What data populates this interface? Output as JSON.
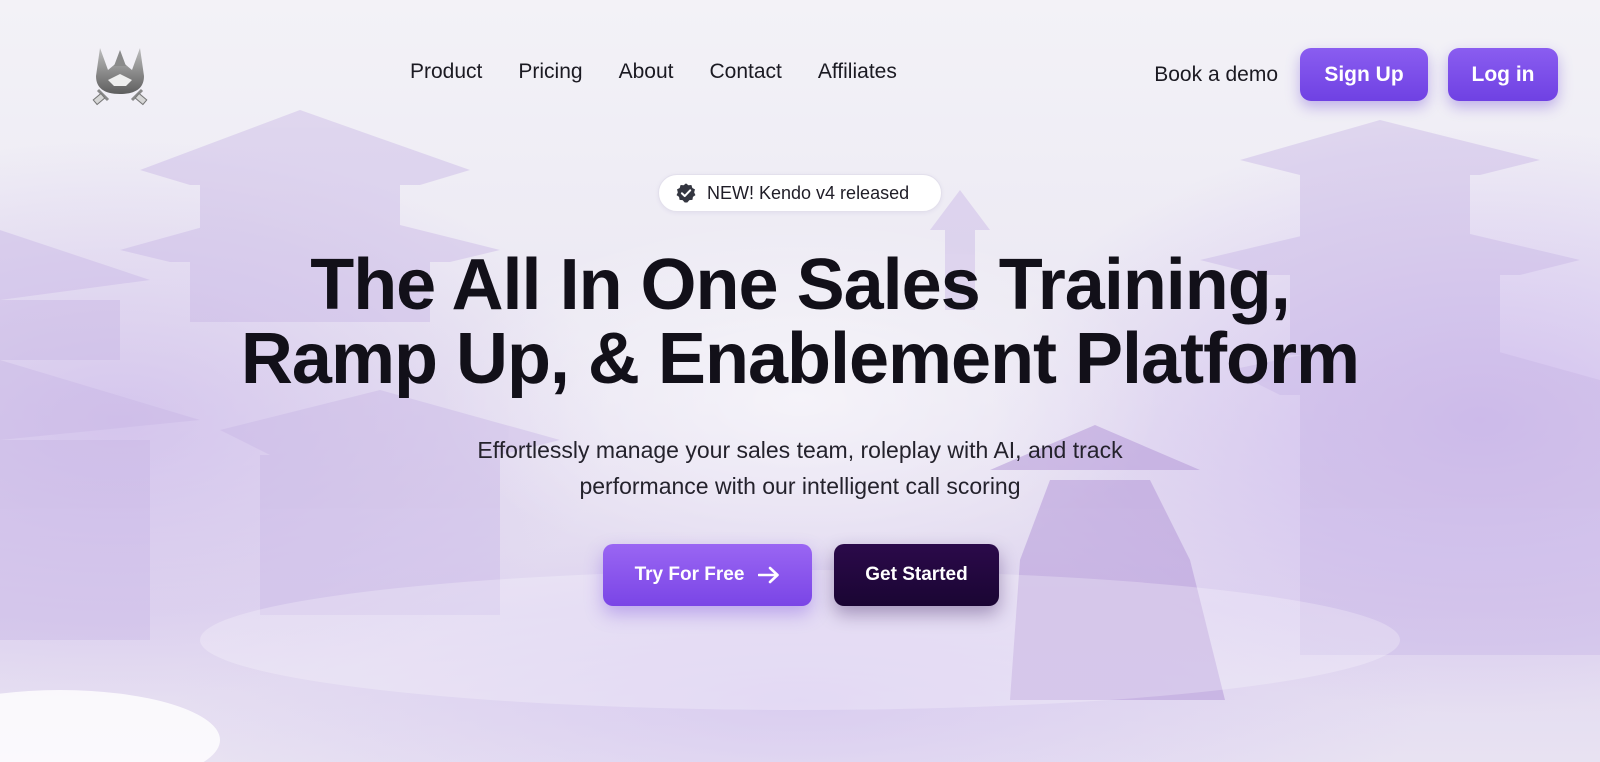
{
  "nav": {
    "logo_icon": "samurai-helmet-logo-icon",
    "links": [
      "Product",
      "Pricing",
      "About",
      "Contact",
      "Affiliates"
    ],
    "book_demo": "Book a demo",
    "signup": "Sign Up",
    "login": "Log in"
  },
  "badge": {
    "icon": "verified-check-icon",
    "text": "NEW! Kendo v4 released"
  },
  "hero": {
    "title_line1": "The All In One Sales Training,",
    "title_line2": "Ramp Up, & Enablement Platform",
    "subtitle_line1": "Effortlessly manage your sales team, roleplay with AI, and track",
    "subtitle_line2": "performance with our intelligent call scoring",
    "cta_primary": "Try For Free",
    "cta_primary_icon": "arrow-right-icon",
    "cta_secondary": "Get Started"
  },
  "colors": {
    "accent": "#7448e6",
    "dark": "#1e0638",
    "background": "#ecebf3"
  }
}
